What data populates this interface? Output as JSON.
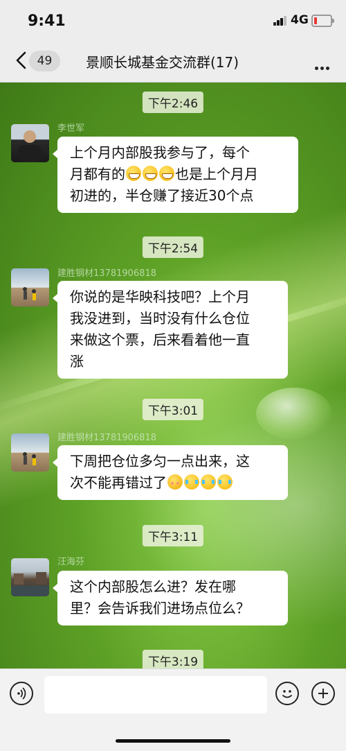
{
  "status_bar": {
    "time": "9:41",
    "network": "4G",
    "battery_color": "#e53935"
  },
  "nav": {
    "unread_count": "49",
    "title": "景顺长城基金交流群(17)"
  },
  "messages": [
    {
      "time": "下午2:46",
      "sender": "李世军",
      "lines": [
        "上个月内部股我参与了，每个",
        "月都有的",
        "也是上个月月",
        "初进的，半仓赚了接近30个点"
      ],
      "emojis": [
        "grinning-face",
        "grinning-face",
        "grinning-face"
      ]
    },
    {
      "time": "下午2:54",
      "sender": "建胜钢材13781906818",
      "lines": [
        "你说的是华映科技吧？上个月",
        "我没进到，当时没有什么仓位",
        "来做这个票，后来看着他一直",
        "涨"
      ]
    },
    {
      "time": "下午3:01",
      "sender": "建胜钢材13781906818",
      "lines": [
        "下周把仓位多匀一点出来，这",
        "次不能再错过了"
      ],
      "emojis": [
        "blushing-face",
        "crying-laughing-face",
        "crying-laughing-face",
        "crying-laughing-face"
      ]
    },
    {
      "time": "下午3:11",
      "sender": "汪海芬",
      "lines": [
        "这个内部股怎么进？发在哪",
        "里？会告诉我们进场点位么？"
      ]
    },
    {
      "time": "下午3:19"
    }
  ],
  "input_bar": {
    "placeholder": ""
  },
  "colors": {
    "bubble": "#ffffff",
    "nav_bg": "#ededed",
    "wallpaper": "#5f9b2d"
  }
}
